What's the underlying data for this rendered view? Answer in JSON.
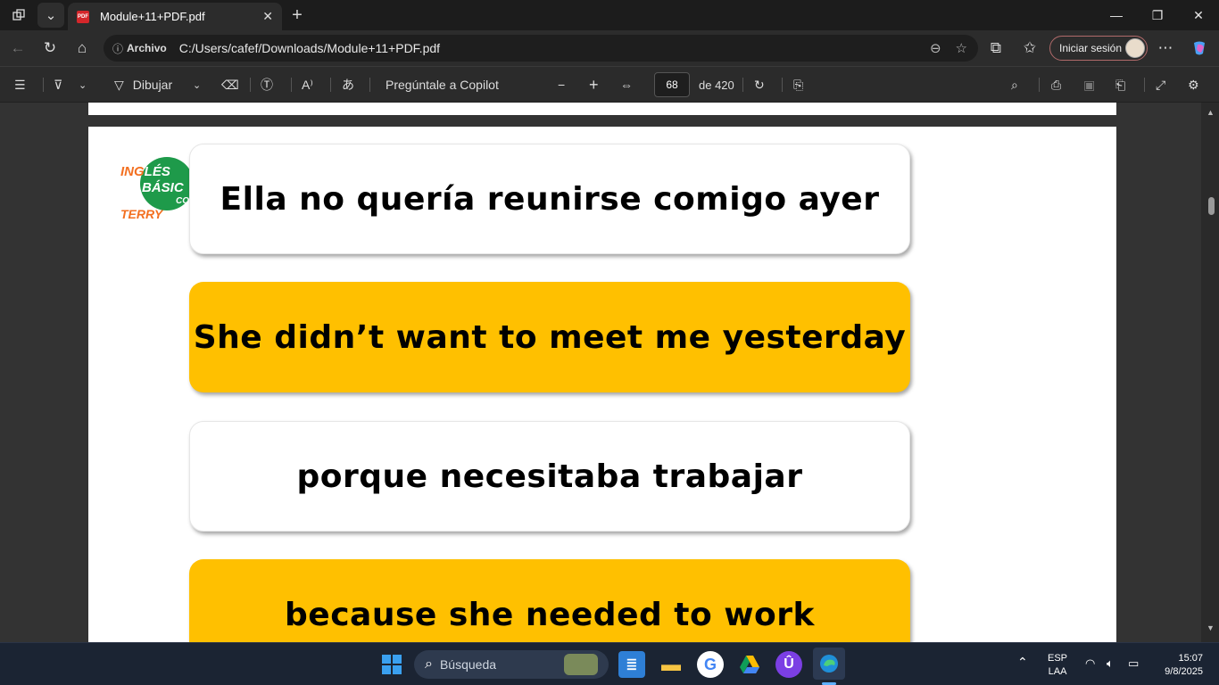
{
  "browser": {
    "tab_title": "Module+11+PDF.pdf",
    "tab_icon_text": "PDF",
    "url_prefix": "Archivo",
    "url": "C:/Users/cafef/Downloads/Module+11+PDF.pdf",
    "signin_label": "Iniciar sesión"
  },
  "pdf_toolbar": {
    "draw_label": "Dibujar",
    "copilot_label": "Pregúntale a Copilot",
    "page_number": "68",
    "page_total": "de 420"
  },
  "document": {
    "logo": {
      "line1a": "ING",
      "line1b": "LÉS",
      "line2": "BÁSIC",
      "line3": "TERRY",
      "line4": "CO"
    },
    "phrases": [
      {
        "text": "Ella no quería reunirse comigo ayer",
        "style": "white"
      },
      {
        "text": "She didn’t want to meet me yesterday",
        "style": "yellow"
      },
      {
        "text": "porque necesitaba trabajar",
        "style": "white"
      },
      {
        "text": "because she needed to work",
        "style": "yellow"
      }
    ],
    "colors": {
      "highlight": "#ffc000",
      "logo_green": "#1e9a4a",
      "logo_orange": "#f37021"
    }
  },
  "taskbar": {
    "search_placeholder": "Búsqueda",
    "language": "ESP",
    "layout": "LAA",
    "time": "15:07",
    "date": "9/8/2025"
  }
}
